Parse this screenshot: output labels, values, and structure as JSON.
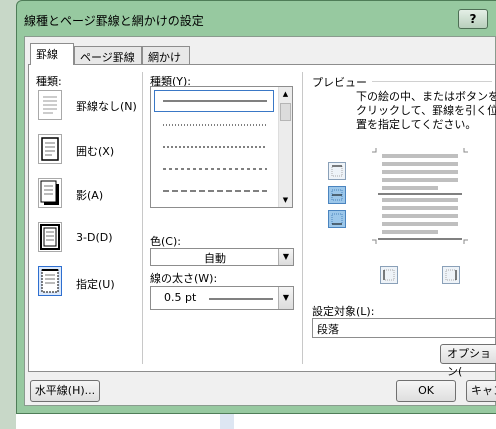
{
  "dialog": {
    "title": "線種とページ罫線と網かけの設定",
    "help_label": "?"
  },
  "tabs": [
    {
      "label": "罫線"
    },
    {
      "label": "ページ罫線"
    },
    {
      "label": "網かけ"
    }
  ],
  "settings": {
    "heading": "種類:",
    "items": [
      {
        "label": "罫線なし(N)"
      },
      {
        "label": "囲む(X)"
      },
      {
        "label": "影(A)"
      },
      {
        "label": "3-D(D)"
      },
      {
        "label": "指定(U)"
      }
    ],
    "selected": "指定(U)"
  },
  "style": {
    "heading": "種類(Y):"
  },
  "color": {
    "label": "色(C):",
    "value": "自動"
  },
  "width": {
    "label": "線の太さ(W):",
    "value": "0.5 pt"
  },
  "preview": {
    "heading": "プレビュー",
    "instructions": [
      "下の絵の中、またはボタンを",
      "クリックして、罫線を引く位",
      "置を指定してください。"
    ]
  },
  "apply_to": {
    "label": "設定対象(L):",
    "value": "段落"
  },
  "buttons": {
    "options": "オプション(",
    "horizontal_line": "水平線(H)...",
    "ok": "OK",
    "cancel": "キャン"
  },
  "colors": {
    "frame": "#97c9a0",
    "selection": "#2e6fd0"
  }
}
